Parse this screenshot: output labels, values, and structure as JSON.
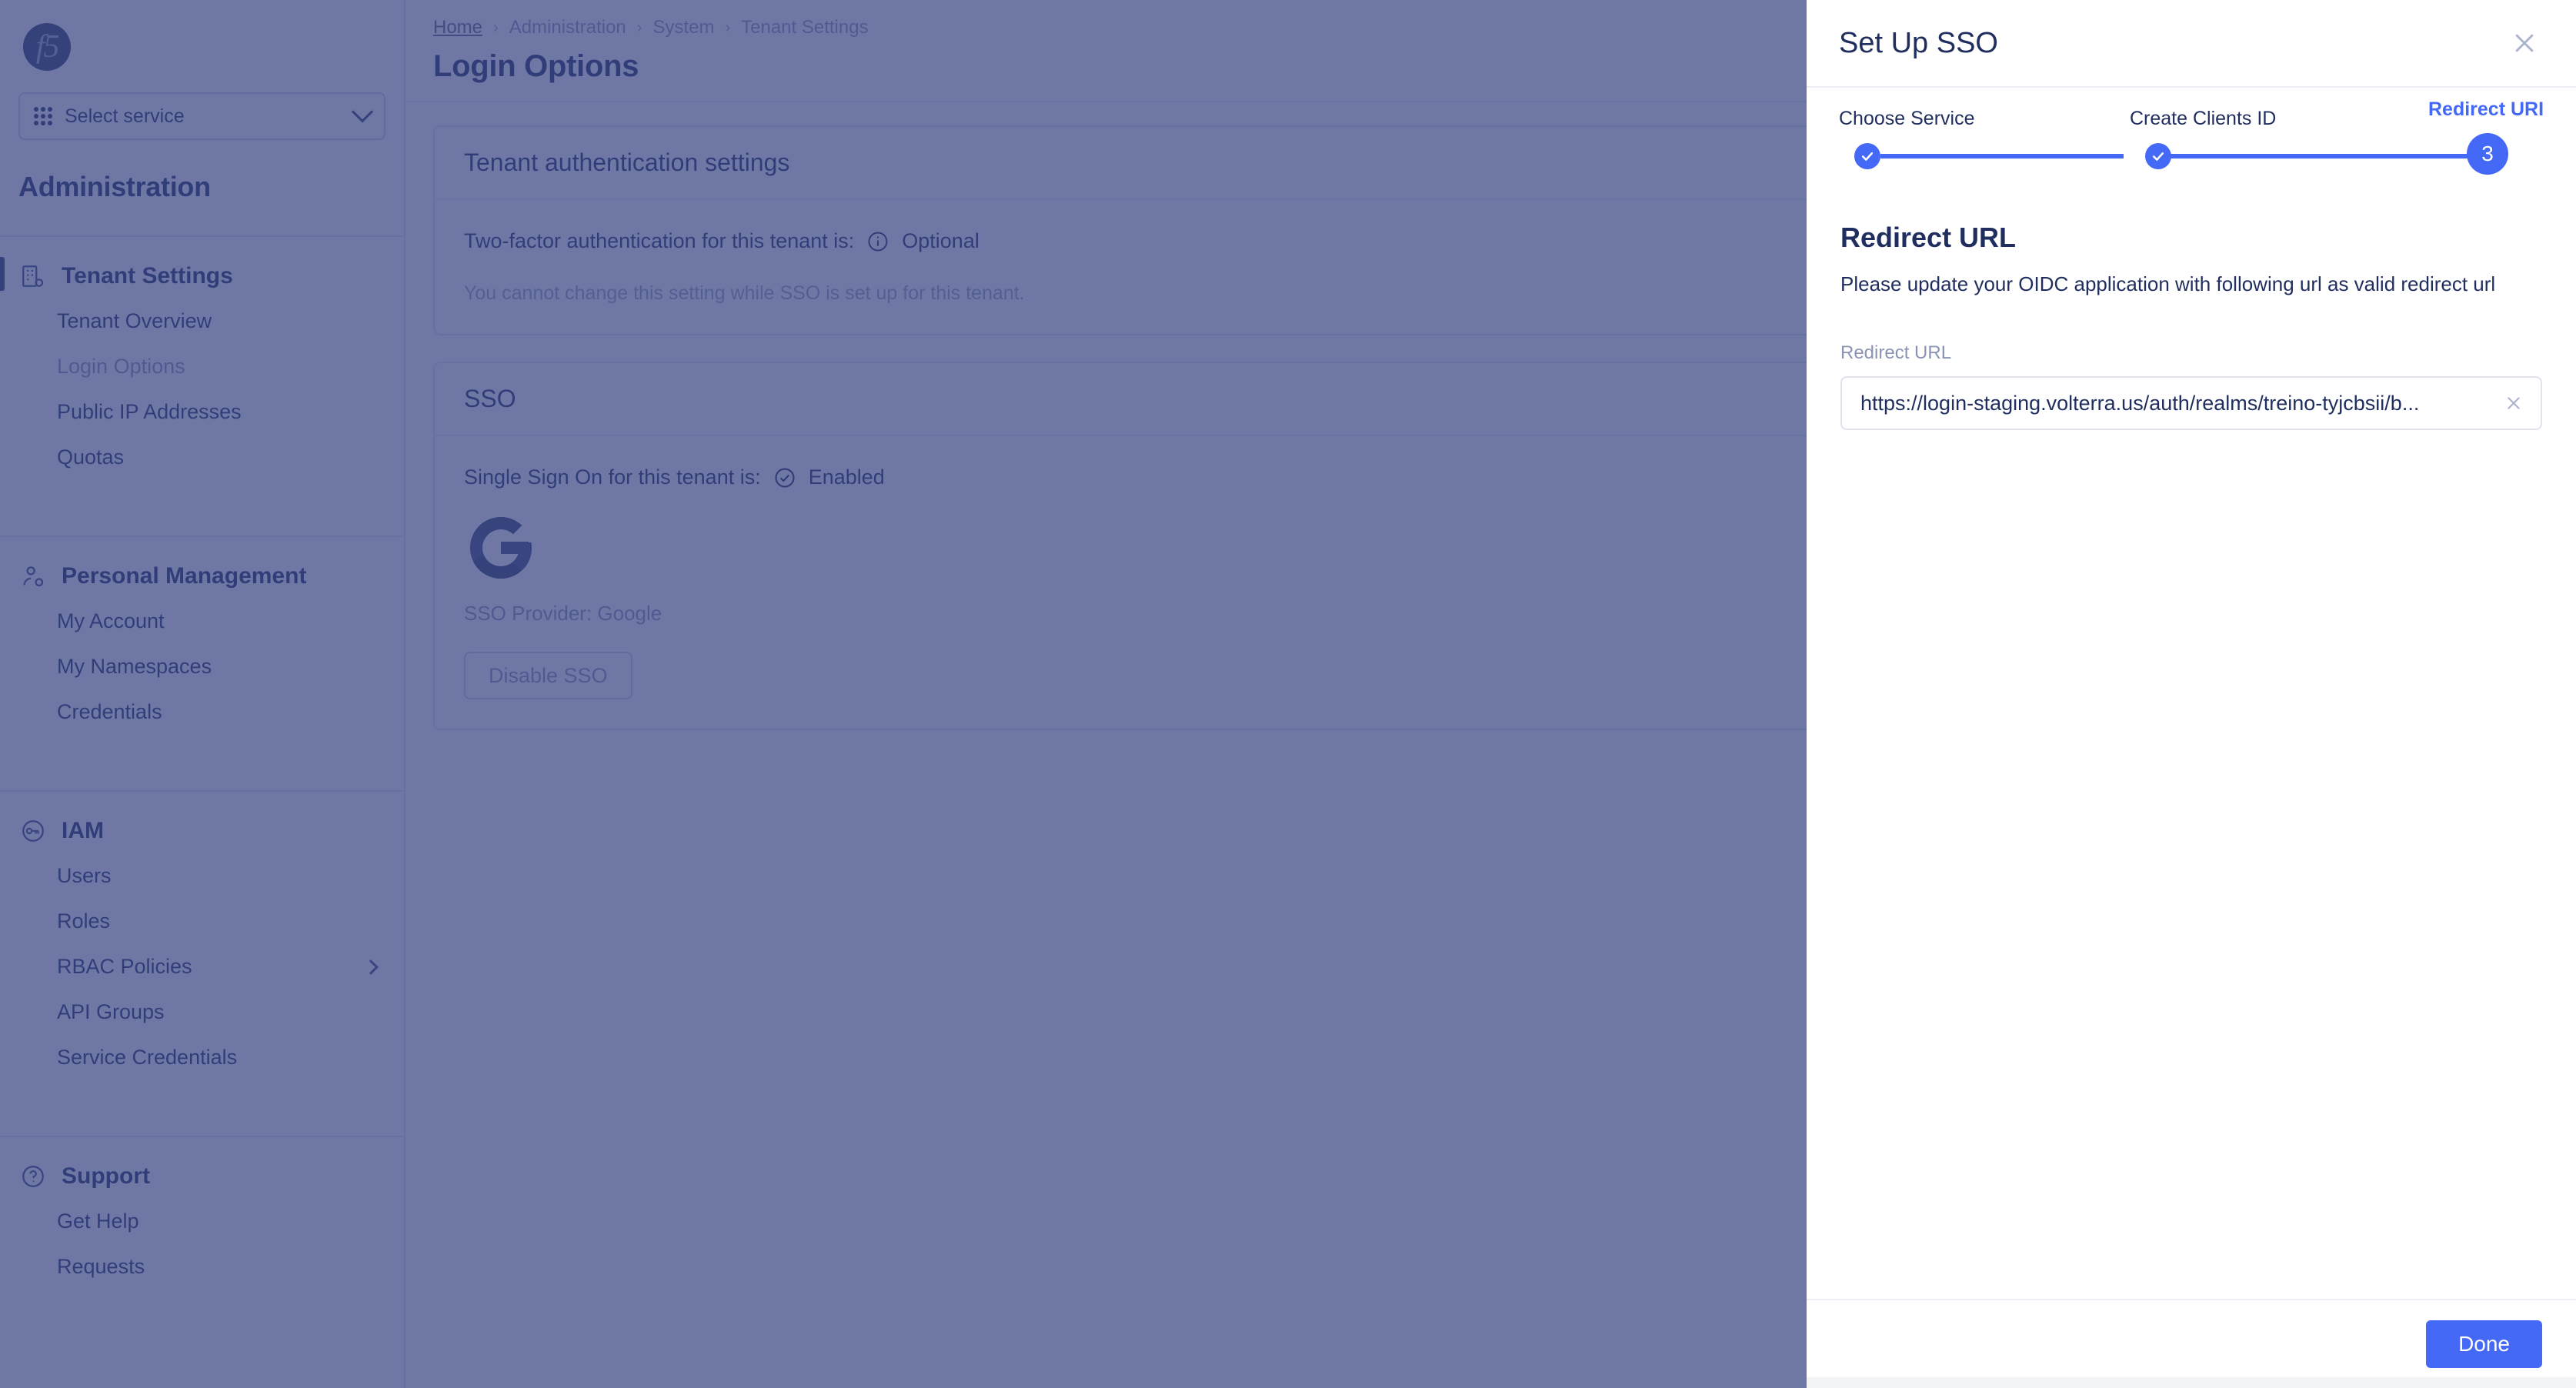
{
  "sidebar": {
    "logo_text": "f5",
    "service_select": {
      "label": "Select service",
      "icon": "apps-grid-icon",
      "chevron": "chevron-down-icon"
    },
    "section_title": "Administration",
    "groups": [
      {
        "label": "Tenant Settings",
        "icon": "building-settings-icon",
        "active": true,
        "items": [
          {
            "label": "Tenant Overview",
            "muted": false,
            "expandable": false
          },
          {
            "label": "Login Options",
            "muted": true,
            "expandable": false
          },
          {
            "label": "Public IP Addresses",
            "muted": false,
            "expandable": false
          },
          {
            "label": "Quotas",
            "muted": false,
            "expandable": false
          }
        ]
      },
      {
        "label": "Personal Management",
        "icon": "user-settings-icon",
        "active": false,
        "items": [
          {
            "label": "My Account",
            "muted": false,
            "expandable": false
          },
          {
            "label": "My Namespaces",
            "muted": false,
            "expandable": false
          },
          {
            "label": "Credentials",
            "muted": false,
            "expandable": false
          }
        ]
      },
      {
        "label": "IAM",
        "icon": "key-icon",
        "active": false,
        "items": [
          {
            "label": "Users",
            "muted": false,
            "expandable": false
          },
          {
            "label": "Roles",
            "muted": false,
            "expandable": false
          },
          {
            "label": "RBAC Policies",
            "muted": false,
            "expandable": true
          },
          {
            "label": "API Groups",
            "muted": false,
            "expandable": false
          },
          {
            "label": "Service Credentials",
            "muted": false,
            "expandable": false
          }
        ]
      },
      {
        "label": "Support",
        "icon": "question-circle-icon",
        "active": false,
        "items": [
          {
            "label": "Get Help",
            "muted": false,
            "expandable": false
          },
          {
            "label": "Requests",
            "muted": false,
            "expandable": false
          }
        ]
      }
    ]
  },
  "main": {
    "breadcrumb": [
      {
        "label": "Home",
        "link": true
      },
      {
        "label": "Administration",
        "link": false
      },
      {
        "label": "System",
        "link": false
      },
      {
        "label": "Tenant Settings",
        "link": false
      }
    ],
    "breadcrumb_separator": "›",
    "page_title": "Login Options",
    "auth_card": {
      "title": "Tenant authentication settings",
      "two_factor_label": "Two-factor authentication for this tenant is:",
      "two_factor_icon": "info-circle-icon",
      "two_factor_value": "Optional",
      "note": "You cannot change this setting while SSO is set up for this tenant."
    },
    "sso_card": {
      "title": "SSO",
      "status_label": "Single Sign On for this tenant is:",
      "status_icon": "check-circle-icon",
      "status_value": "Enabled",
      "provider_logo": "google-g-icon",
      "provider_text": "SSO Provider: Google",
      "disable_button": "Disable SSO"
    }
  },
  "panel": {
    "title": "Set Up SSO",
    "close_icon": "close-icon",
    "steps": [
      {
        "number": "1",
        "label": "Choose Service",
        "state": "done",
        "icon": "check-icon"
      },
      {
        "number": "2",
        "label": "Create Clients ID",
        "state": "done",
        "icon": "check-icon"
      },
      {
        "number": "3",
        "label": "Redirect URI",
        "state": "current",
        "icon": ""
      }
    ],
    "section_title": "Redirect URL",
    "section_desc": "Please update your OIDC application with following url as valid redirect url",
    "field": {
      "label": "Redirect URL",
      "value": "https://login-staging.volterra.us/auth/realms/treino-tyjcbsii/b...",
      "clear_icon": "clear-x-icon"
    },
    "footer": {
      "done_label": "Done"
    }
  },
  "colors": {
    "accent": "#4569f7",
    "navy": "#1f2e5e",
    "muted": "#8b93b5",
    "overlay": "#374482",
    "border": "#e3e6ef"
  }
}
